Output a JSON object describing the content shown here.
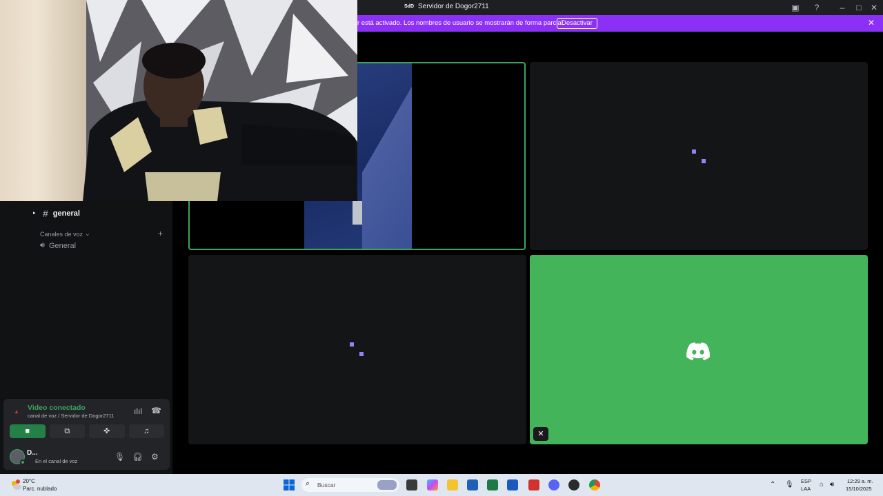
{
  "titlebar": {
    "server_icon_text": "SdD",
    "server_name": "Servidor de Dogor2711"
  },
  "banner": {
    "message": "r está activado. Los nombres de usuario se mostrarán de forma parcial.",
    "disable_label": "Desactivar"
  },
  "sidebar": {
    "text_channel": "general",
    "voice_category": "Canales de voz",
    "voice_channel": "General"
  },
  "voice_panel": {
    "title": "Video conectado",
    "subtitle": "canal de voz / Servidor de Dogor2711"
  },
  "user": {
    "name": "D...",
    "status": "En el canal de voz"
  },
  "taskbar": {
    "weather_temp": "20°C",
    "weather_desc": "Parc. nublado",
    "search_placeholder": "Buscar",
    "lang_line1": "ESP",
    "lang_line2": "LAA",
    "time": "12:29 a. m.",
    "date": "15/10/2025"
  },
  "colors": {
    "banner": "#8c30f5",
    "connected_green": "#3ba55d",
    "tile_green": "#43b45a",
    "loading_dot": "#8f86f5"
  }
}
